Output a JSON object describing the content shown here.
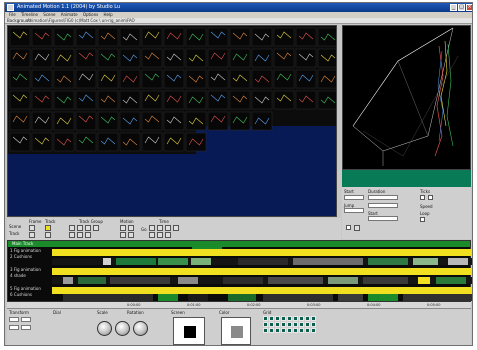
{
  "window": {
    "title": "Animated Motion 1.1 (2004) by Studio Lu",
    "controls": {
      "minimize": "_",
      "maximize": "□",
      "close": "×"
    }
  },
  "menu": [
    "File",
    "Timeline",
    "Scene",
    "Animate",
    "Options",
    "Help"
  ],
  "pathbar": {
    "label": "Background",
    "path": "Animation\\Figures\\FIG0 (c)Matt Cox \\ un-rig_anim\\FAO"
  },
  "toolbar": {
    "groups": [
      "Frame",
      "Track",
      "Track Group",
      "Motion",
      "Time"
    ],
    "row_labels": [
      "Scene",
      "Track"
    ],
    "play_label": "Go"
  },
  "right_panel": {
    "labels": [
      "Start",
      "Duration",
      "Ticks",
      "Jump",
      "Start",
      "Speed",
      "Loop"
    ]
  },
  "timeline": {
    "header": "Main Track",
    "tracks": [
      "1 Fig animation",
      "2 Cushions",
      "3 Fig animation",
      "4 shade",
      "5 Fig animation",
      "6 Cushions"
    ],
    "ruler_ticks": [
      "0:00:00",
      "0:01:00",
      "0:02:00",
      "0:03:00",
      "0:04:00",
      "0:05:00"
    ]
  },
  "bottom": {
    "labels": [
      "Transform",
      "Dial",
      "Scale",
      "Rotation",
      "Screen",
      "Color",
      "Grid"
    ]
  },
  "colors": {
    "titlebar": "#0b3a8c",
    "timeline_yellow": "#f0e020",
    "preview_strip": "#087a56",
    "library_bg": "#081a55"
  }
}
